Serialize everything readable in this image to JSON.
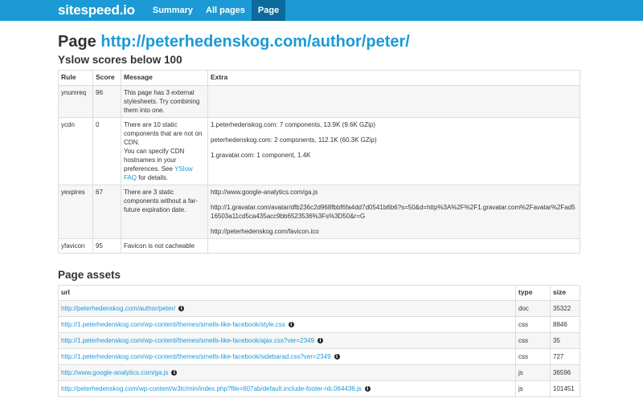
{
  "navbar": {
    "brand": "sitespeed.io",
    "items": [
      {
        "label": "Summary",
        "active": false
      },
      {
        "label": "All pages",
        "active": false
      },
      {
        "label": "Page",
        "active": true
      }
    ]
  },
  "page": {
    "title_prefix": "Page",
    "url": "http://peterhedenskog.com/author/peter/"
  },
  "yslow": {
    "heading": "Yslow scores below 100",
    "columns": [
      "Rule",
      "Score",
      "Message",
      "Extra"
    ],
    "rows": [
      {
        "rule": "ynumreq",
        "score": "96",
        "message": "This page has 3 external stylesheets. Try combining them into one.",
        "extra": []
      },
      {
        "rule": "ycdn",
        "score": "0",
        "message_before": "There are 10 static components that are not on CDN.",
        "message_mid": "You can specify CDN hostnames in your preferences. See",
        "message_link": "YSlow FAQ",
        "message_after": "for details.",
        "extra": [
          "1.peterhedenskog.com: 7 components, 13.9K (9.6K GZip)",
          "peterhedenskog.com: 2 components, 112.1K (60.3K GZip)",
          "1.gravatar.com: 1 component, 1.4K"
        ]
      },
      {
        "rule": "yexpires",
        "score": "67",
        "message": "There are 3 static components without a far-future expiration date.",
        "extra": [
          "http://www.google-analytics.com/ga.js",
          "http://1.gravatar.com/avatar/dfb236c2d968fbbf6fa4dd7d0541b6b6?s=50&d=http%3A%2F%2F1.gravatar.com%2Favatar%2Fad516503a11cd5ca435acc9bb6523536%3Fs%3D50&r=G",
          "http://peterhedenskog.com/favicon.ico"
        ]
      },
      {
        "rule": "yfavicon",
        "score": "95",
        "message": "Favicon is not cacheable",
        "extra": []
      }
    ]
  },
  "assets": {
    "heading": "Page assets",
    "columns": [
      "url",
      "type",
      "size"
    ],
    "rows": [
      {
        "url": "http://peterhedenskog.com/author/peter/",
        "type": "doc",
        "size": "35322"
      },
      {
        "url": "http://1.peterhedenskog.com/wp-content/themes/smells-like-facebook/style.css",
        "type": "css",
        "size": "8846"
      },
      {
        "url": "http://1.peterhedenskog.com/wp-content/themes/smells-like-facebook/ajax.css?ver=2349",
        "type": "css",
        "size": "35"
      },
      {
        "url": "http://1.peterhedenskog.com/wp-content/themes/smells-like-facebook/sidebarad.css?ver=2349",
        "type": "css",
        "size": "727"
      },
      {
        "url": "http://www.google-analytics.com/ga.js",
        "type": "js",
        "size": "36596"
      },
      {
        "url": "http://peterhedenskog.com/wp-content/w3tc/min/index.php?file=607ab/default.include-footer-nb.064436.js",
        "type": "js",
        "size": "101451"
      }
    ]
  },
  "icons": {
    "info": "info-icon"
  },
  "colors": {
    "navbar": "#1b9ad6",
    "nav_active": "#0c6a9c",
    "link": "#1b9ad6"
  }
}
